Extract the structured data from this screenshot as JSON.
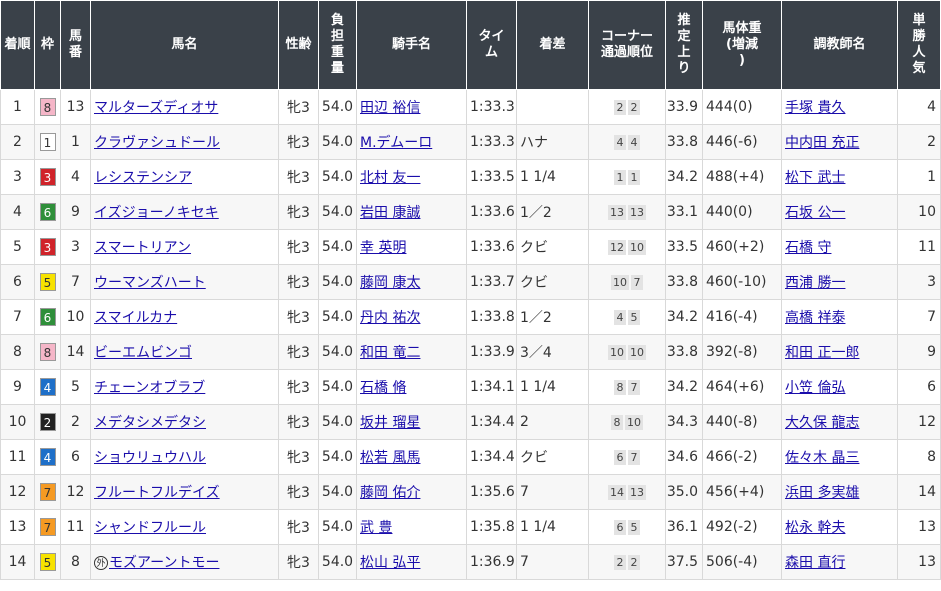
{
  "headers": {
    "rank": "着順",
    "frame": "枠",
    "number": "馬番",
    "horse": "馬名",
    "sexage": "性齢",
    "weight": "負担重量",
    "jockey": "騎手名",
    "time": "タイム",
    "margin": "着差",
    "corner": "コーナー通過順位",
    "last3f": "推定上り",
    "bodyweight": "馬体重(増減)",
    "trainer": "調教師名",
    "popularity": "単勝人気"
  },
  "waku_colors": {
    "1": {
      "bg": "#ffffff",
      "fg": "#333333"
    },
    "2": {
      "bg": "#222222",
      "fg": "#ffffff"
    },
    "3": {
      "bg": "#d0232a",
      "fg": "#ffffff"
    },
    "4": {
      "bg": "#1e6fc8",
      "fg": "#ffffff"
    },
    "5": {
      "bg": "#f7e200",
      "fg": "#333333"
    },
    "6": {
      "bg": "#2f8f3a",
      "fg": "#ffffff"
    },
    "7": {
      "bg": "#f59a23",
      "fg": "#333333"
    },
    "8": {
      "bg": "#f5b6c8",
      "fg": "#333333"
    }
  },
  "rows": [
    {
      "rank": "1",
      "frame": "8",
      "number": "13",
      "horse": "マルターズディオサ",
      "foreign": false,
      "sexage": "牝3",
      "weight": "54.0",
      "jockey": "田辺 裕信",
      "time": "1:33.3",
      "margin": "",
      "c1": "2",
      "c2": "2",
      "last3f": "33.9",
      "bodyweight": "444(0)",
      "trainer": "手塚 貴久",
      "popularity": "4"
    },
    {
      "rank": "2",
      "frame": "1",
      "number": "1",
      "horse": "クラヴァシュドール",
      "foreign": false,
      "sexage": "牝3",
      "weight": "54.0",
      "jockey": "M.デムーロ",
      "time": "1:33.3",
      "margin": "ハナ",
      "c1": "4",
      "c2": "4",
      "last3f": "33.8",
      "bodyweight": "446(-6)",
      "trainer": "中内田 充正",
      "popularity": "2"
    },
    {
      "rank": "3",
      "frame": "3",
      "number": "4",
      "horse": "レシステンシア",
      "foreign": false,
      "sexage": "牝3",
      "weight": "54.0",
      "jockey": "北村 友一",
      "time": "1:33.5",
      "margin": "1 1/4",
      "c1": "1",
      "c2": "1",
      "last3f": "34.2",
      "bodyweight": "488(+4)",
      "trainer": "松下 武士",
      "popularity": "1"
    },
    {
      "rank": "4",
      "frame": "6",
      "number": "9",
      "horse": "イズジョーノキセキ",
      "foreign": false,
      "sexage": "牝3",
      "weight": "54.0",
      "jockey": "岩田 康誠",
      "time": "1:33.6",
      "margin": "1／2",
      "c1": "13",
      "c2": "13",
      "last3f": "33.1",
      "bodyweight": "440(0)",
      "trainer": "石坂 公一",
      "popularity": "10"
    },
    {
      "rank": "5",
      "frame": "3",
      "number": "3",
      "horse": "スマートリアン",
      "foreign": false,
      "sexage": "牝3",
      "weight": "54.0",
      "jockey": "幸 英明",
      "time": "1:33.6",
      "margin": "クビ",
      "c1": "12",
      "c2": "10",
      "last3f": "33.5",
      "bodyweight": "460(+2)",
      "trainer": "石橋 守",
      "popularity": "11"
    },
    {
      "rank": "6",
      "frame": "5",
      "number": "7",
      "horse": "ウーマンズハート",
      "foreign": false,
      "sexage": "牝3",
      "weight": "54.0",
      "jockey": "藤岡 康太",
      "time": "1:33.7",
      "margin": "クビ",
      "c1": "10",
      "c2": "7",
      "last3f": "33.8",
      "bodyweight": "460(-10)",
      "trainer": "西浦 勝一",
      "popularity": "3"
    },
    {
      "rank": "7",
      "frame": "6",
      "number": "10",
      "horse": "スマイルカナ",
      "foreign": false,
      "sexage": "牝3",
      "weight": "54.0",
      "jockey": "丹内 祐次",
      "time": "1:33.8",
      "margin": "1／2",
      "c1": "4",
      "c2": "5",
      "last3f": "34.2",
      "bodyweight": "416(-4)",
      "trainer": "高橋 祥泰",
      "popularity": "7"
    },
    {
      "rank": "8",
      "frame": "8",
      "number": "14",
      "horse": "ビーエムビンゴ",
      "foreign": false,
      "sexage": "牝3",
      "weight": "54.0",
      "jockey": "和田 竜二",
      "time": "1:33.9",
      "margin": "3／4",
      "c1": "10",
      "c2": "10",
      "last3f": "33.8",
      "bodyweight": "392(-8)",
      "trainer": "和田 正一郎",
      "popularity": "9"
    },
    {
      "rank": "9",
      "frame": "4",
      "number": "5",
      "horse": "チェーンオブラブ",
      "foreign": false,
      "sexage": "牝3",
      "weight": "54.0",
      "jockey": "石橋 脩",
      "time": "1:34.1",
      "margin": "1 1/4",
      "c1": "8",
      "c2": "7",
      "last3f": "34.2",
      "bodyweight": "464(+6)",
      "trainer": "小笠 倫弘",
      "popularity": "6"
    },
    {
      "rank": "10",
      "frame": "2",
      "number": "2",
      "horse": "メデタシメデタシ",
      "foreign": false,
      "sexage": "牝3",
      "weight": "54.0",
      "jockey": "坂井 瑠星",
      "time": "1:34.4",
      "margin": "2",
      "c1": "8",
      "c2": "10",
      "last3f": "34.3",
      "bodyweight": "440(-8)",
      "trainer": "大久保 龍志",
      "popularity": "12"
    },
    {
      "rank": "11",
      "frame": "4",
      "number": "6",
      "horse": "ショウリュウハル",
      "foreign": false,
      "sexage": "牝3",
      "weight": "54.0",
      "jockey": "松若 風馬",
      "time": "1:34.4",
      "margin": "クビ",
      "c1": "6",
      "c2": "7",
      "last3f": "34.6",
      "bodyweight": "466(-2)",
      "trainer": "佐々木 晶三",
      "popularity": "8"
    },
    {
      "rank": "12",
      "frame": "7",
      "number": "12",
      "horse": "フルートフルデイズ",
      "foreign": false,
      "sexage": "牝3",
      "weight": "54.0",
      "jockey": "藤岡 佑介",
      "time": "1:35.6",
      "margin": "7",
      "c1": "14",
      "c2": "13",
      "last3f": "35.0",
      "bodyweight": "456(+4)",
      "trainer": "浜田 多実雄",
      "popularity": "14"
    },
    {
      "rank": "13",
      "frame": "7",
      "number": "11",
      "horse": "シャンドフルール",
      "foreign": false,
      "sexage": "牝3",
      "weight": "54.0",
      "jockey": "武 豊",
      "time": "1:35.8",
      "margin": "1 1/4",
      "c1": "6",
      "c2": "5",
      "last3f": "36.1",
      "bodyweight": "492(-2)",
      "trainer": "松永 幹夫",
      "popularity": "13"
    },
    {
      "rank": "14",
      "frame": "5",
      "number": "8",
      "horse": "モズアーントモー",
      "foreign": true,
      "foreign_mark": "外",
      "sexage": "牝3",
      "weight": "54.0",
      "jockey": "松山 弘平",
      "time": "1:36.9",
      "margin": "7",
      "c1": "2",
      "c2": "2",
      "last3f": "37.5",
      "bodyweight": "506(-4)",
      "trainer": "森田 直行",
      "popularity": "13"
    }
  ]
}
